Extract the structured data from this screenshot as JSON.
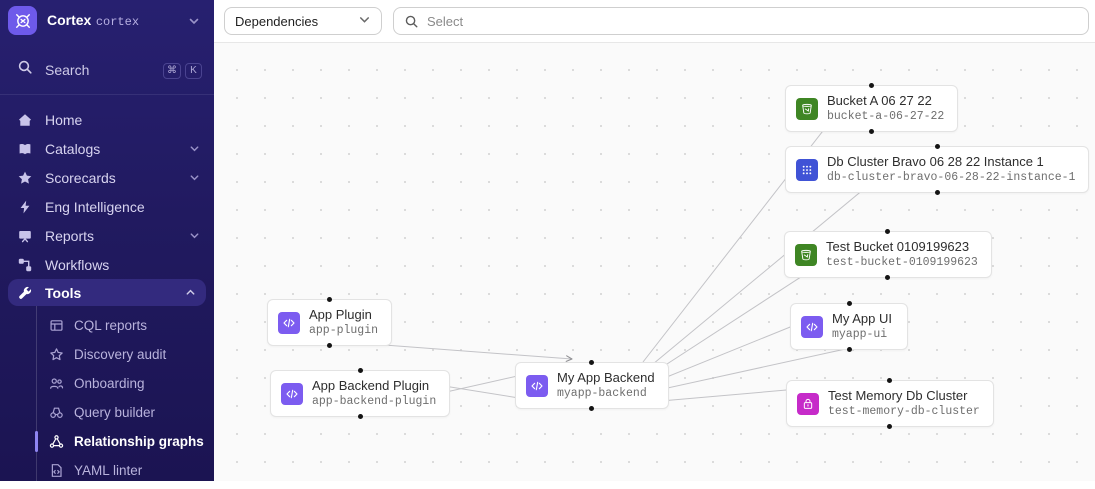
{
  "brand": {
    "name": "Cortex",
    "workspace": "cortex"
  },
  "sidebar": {
    "search": {
      "label": "Search",
      "shortcut_keys": [
        "⌘",
        "K"
      ]
    },
    "items": [
      {
        "label": "Home"
      },
      {
        "label": "Catalogs",
        "expandable": true
      },
      {
        "label": "Scorecards",
        "expandable": true
      },
      {
        "label": "Eng Intelligence"
      },
      {
        "label": "Reports",
        "expandable": true
      },
      {
        "label": "Workflows"
      },
      {
        "label": "Tools",
        "expandable": true,
        "expanded": true
      }
    ],
    "tools_children": [
      {
        "label": "CQL reports"
      },
      {
        "label": "Discovery audit"
      },
      {
        "label": "Onboarding"
      },
      {
        "label": "Query builder"
      },
      {
        "label": "Relationship graphs",
        "active": true
      },
      {
        "label": "YAML linter"
      }
    ]
  },
  "topbar": {
    "relationship_type": "Dependencies",
    "entity_search_placeholder": "Select"
  },
  "graph": {
    "nodes": [
      {
        "id": "bucket-a",
        "title": "Bucket A 06 27 22",
        "subtitle": "bucket-a-06-27-22",
        "icon": "s3-bucket-icon"
      },
      {
        "id": "db-cluster-bravo",
        "title": "Db Cluster Bravo 06 28 22 Instance 1",
        "subtitle": "db-cluster-bravo-06-28-22-instance-1",
        "icon": "dynamodb-icon"
      },
      {
        "id": "test-bucket",
        "title": "Test Bucket 0109199623",
        "subtitle": "test-bucket-0109199623",
        "icon": "s3-bucket-icon"
      },
      {
        "id": "myapp-ui",
        "title": "My App UI",
        "subtitle": "myapp-ui",
        "icon": "code-icon"
      },
      {
        "id": "test-memory-db-cluster",
        "title": "Test Memory Db Cluster",
        "subtitle": "test-memory-db-cluster",
        "icon": "memorydb-icon"
      },
      {
        "id": "app-plugin",
        "title": "App Plugin",
        "subtitle": "app-plugin",
        "icon": "code-icon"
      },
      {
        "id": "app-backend-plugin",
        "title": "App Backend Plugin",
        "subtitle": "app-backend-plugin",
        "icon": "code-icon"
      },
      {
        "id": "myapp-backend",
        "title": "My App Backend",
        "subtitle": "myapp-backend",
        "icon": "code-icon"
      }
    ],
    "edges": [
      {
        "from": "app-plugin",
        "to": "myapp-backend"
      },
      {
        "from": "app-backend-plugin",
        "to": "myapp-backend"
      },
      {
        "from": "myapp-backend",
        "to": "app-backend-plugin"
      },
      {
        "from": "myapp-backend",
        "to": "bucket-a"
      },
      {
        "from": "myapp-backend",
        "to": "db-cluster-bravo"
      },
      {
        "from": "myapp-backend",
        "to": "test-bucket"
      },
      {
        "from": "myapp-backend",
        "to": "myapp-ui"
      },
      {
        "from": "myapp-backend",
        "to": "test-memory-db-cluster"
      },
      {
        "from": "myapp-ui",
        "to": "myapp-backend"
      }
    ],
    "colors": {
      "s3_icon": "#3F8624",
      "dynamodb_icon": "#4053D6",
      "code_icon": "#7C5CF0",
      "memorydb_icon": "#C62BC9",
      "sidebar_bg": "#211A60",
      "brand_accent": "#6E5AEA"
    }
  }
}
